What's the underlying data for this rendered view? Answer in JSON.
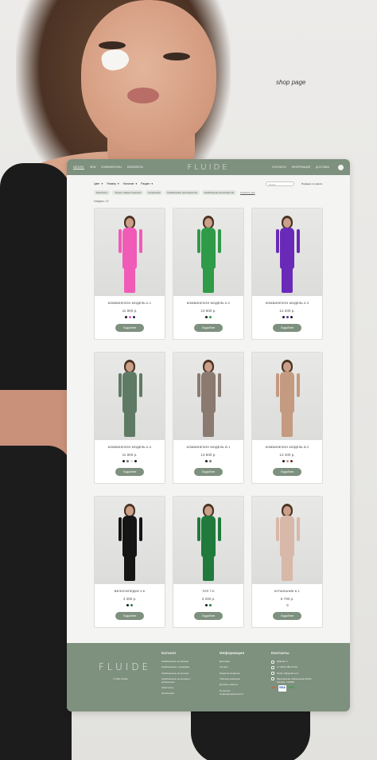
{
  "shop_label": "shop page",
  "nav": {
    "logo": "FLUIDE",
    "left": [
      "КАТАЛОГ",
      "NEW",
      "КОМБИНЕЗОНЫ",
      "КОМПЛЕКТЫ"
    ],
    "right": [
      "КОНТАКТЫ",
      "ИНФОРМАЦИЯ",
      "ДОСТАВКА"
    ]
  },
  "filters": {
    "items": [
      "Цвет",
      "Размер",
      "Наличие",
      "Раздел"
    ],
    "search_placeholder": "Поиск",
    "sort": "Порядок: по умолч."
  },
  "chips": [
    "Комплекты",
    "Только товары в наличии",
    "Купальники",
    "Комбинезоны (коллекция 2к)",
    "Комбинезоны (коллекция 1к)"
  ],
  "clear_label": "Очистить все",
  "found": "Найдено: 15",
  "products": [
    {
      "title": "КОМБИНЕЗОН МОДЕЛЬ К.1",
      "price": "11 900 р.",
      "button": "Подробнее",
      "color": "#f05bb8",
      "dots": [
        "#1a1a1a",
        "#f05bb8",
        "#1b2a5a"
      ]
    },
    {
      "title": "КОМБИНЕЗОН МОДЕЛЬ К.2",
      "price": "10 900 р.",
      "button": "Подробнее",
      "color": "#2f9a48",
      "dots": [
        "#1a1a1a",
        "#2f9a48"
      ]
    },
    {
      "title": "КОМБИНЕЗОН МОДЕЛЬ К.3",
      "price": "12 200 р.",
      "button": "Подробнее",
      "color": "#6a2ab8",
      "dots": [
        "#1a1a1a",
        "#6a2ab8",
        "#1a1a1a"
      ]
    },
    {
      "title": "КОМБИНЕЗОН МОДЕЛЬ К.4",
      "price": "11 900 р.",
      "button": "Подробнее",
      "color": "#5f7a64",
      "dots": [
        "#1a1a1a",
        "#5f7a64",
        "#e8e0d6",
        "#1a1a1a"
      ]
    },
    {
      "title": "КОМБИНЕЗОН МОДЕЛЬ В.1",
      "price": "13 900 р.",
      "button": "Подробнее",
      "color": "#8a7a70",
      "dots": [
        "#1a1a1a",
        "#8a7a70"
      ]
    },
    {
      "title": "КОМБИНЕЗОН МОДЕЛЬ В.2",
      "price": "12 400 р.",
      "button": "Подробнее",
      "color": "#c49a80",
      "dots": [
        "#1a1a1a",
        "#c49a80",
        "#6a2a2a"
      ]
    },
    {
      "title": "ВЕЛОСИПЕДКИ V.К",
      "price": "4 300 р.",
      "button": "Подробнее",
      "color": "#151515",
      "dots": [
        "#1a1a1a",
        "#2f7a4a"
      ]
    },
    {
      "title": "ТОП T.K",
      "price": "3 200 р.",
      "button": "Подробнее",
      "color": "#1f7a3c",
      "dots": [
        "#1a1a1a",
        "#1f7a3c"
      ]
    },
    {
      "title": "КУПАЛЬНИК K.1",
      "price": "5 700 р.",
      "button": "Подробнее",
      "color": "#d8b8a8",
      "dots": [
        "#d8b8a8"
      ]
    }
  ],
  "footer": {
    "logo": "FLUIDE",
    "copyright": "© 2021 Fluide",
    "catalog_title": "Каталог",
    "catalog": [
      "Комбинезоны на брюках",
      "Комбинезоны с рукавами",
      "Комбинезоны на молнии",
      "Комбинезоны на молнии с капюшоном",
      "Комплекты",
      "Купальники"
    ],
    "info_title": "Информация",
    "info": [
      "Доставка",
      "Оплата",
      "Правила возврата",
      "Таблица размеров",
      "Договор оферты",
      "Политика конфиденциальности"
    ],
    "contacts_title": "Контакты",
    "contacts": [
      "@fluide.ru",
      "+7 (916) 286-13-40",
      "fluide.ru@gmail.com",
      "Варшавская набережная 35/2А, Москва, 123059"
    ],
    "payments": [
      "mc",
      "VISA",
      "МИР"
    ]
  },
  "colors": {
    "accent": "#7e907e",
    "footer_bg": "#7e907e"
  }
}
